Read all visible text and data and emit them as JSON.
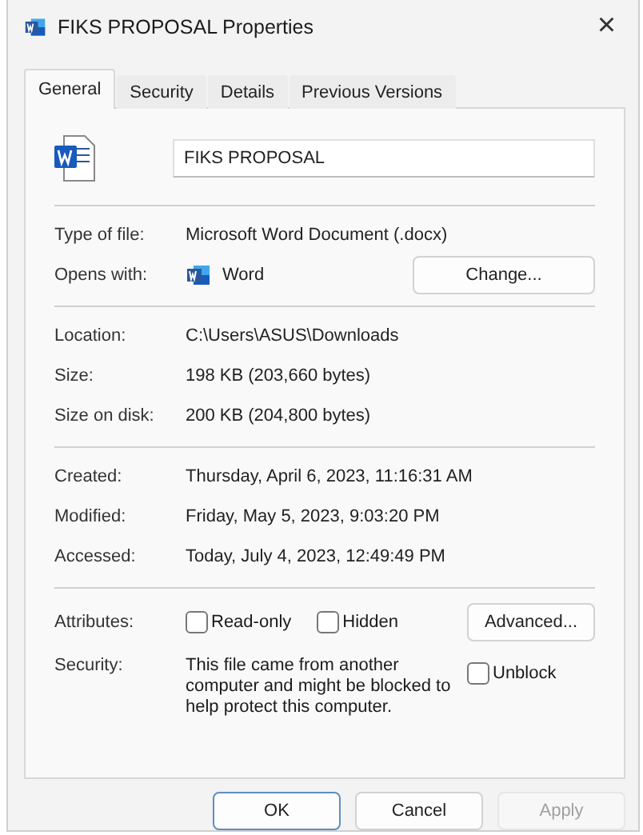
{
  "window": {
    "title": "FIKS PROPOSAL Properties",
    "close": "×"
  },
  "tabs": [
    {
      "label": "General",
      "selected": true
    },
    {
      "label": "Security",
      "selected": false
    },
    {
      "label": "Details",
      "selected": false
    },
    {
      "label": "Previous Versions",
      "selected": false
    }
  ],
  "file_name": {
    "value": "FIKS PROPOSAL"
  },
  "type_of_file": {
    "label": "Type of file:",
    "value": "Microsoft Word Document (.docx)"
  },
  "opens_with": {
    "label": "Opens with:",
    "app": "Word",
    "button": "Change..."
  },
  "location_group": [
    {
      "label": "Location:",
      "value": "C:\\Users\\ASUS\\Downloads"
    },
    {
      "label": "Size:",
      "value": "198 KB (203,660 bytes)"
    },
    {
      "label": "Size on disk:",
      "value": "200 KB (204,800 bytes)"
    }
  ],
  "date_group": [
    {
      "label": "Created:",
      "value": "Thursday, April 6, 2023, 11:16:31 AM"
    },
    {
      "label": "Modified:",
      "value": "Friday, May 5, 2023, 9:03:20 PM"
    },
    {
      "label": "Accessed:",
      "value": "Today, July 4, 2023, 12:49:49 PM"
    }
  ],
  "attributes": {
    "label": "Attributes:",
    "options": [
      {
        "label": "Read-only",
        "checked": false
      },
      {
        "label": "Hidden",
        "checked": false
      }
    ],
    "button": "Advanced..."
  },
  "security": {
    "label": "Security:",
    "text": "This file came from another computer and might be blocked to help protect this computer.",
    "unblock": {
      "label": "Unblock",
      "checked": false
    }
  },
  "buttons": [
    {
      "label": "OK",
      "kind": "default",
      "disabled": false
    },
    {
      "label": "Cancel",
      "kind": "normal",
      "disabled": false
    },
    {
      "label": "Apply",
      "kind": "normal",
      "disabled": true
    }
  ]
}
